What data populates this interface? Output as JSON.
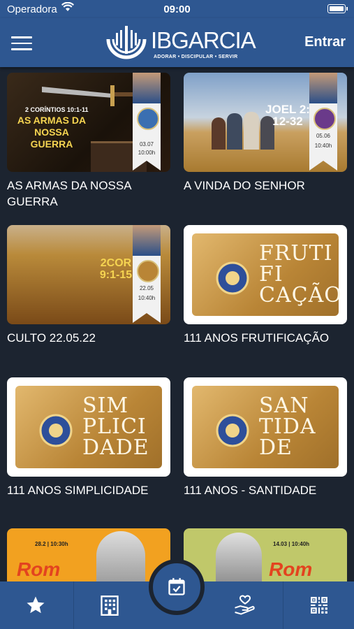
{
  "status_bar": {
    "carrier": "Operadora",
    "time": "09:00"
  },
  "header": {
    "logo_text": "IBGARCIA",
    "logo_subtitle": "ADORAR • DISCIPULAR • SERVIR",
    "login_label": "Entrar"
  },
  "cards": [
    {
      "title": "AS ARMAS DA NOSSA GUERRA",
      "thumb_ref": "2 CORÍNTIOS 10:1-11",
      "thumb_heading": "AS ARMAS DA NOSSA GUERRA",
      "ribbon_date": "03.07",
      "ribbon_time": "10:00h"
    },
    {
      "title": "A VINDA DO SENHOR",
      "thumb_ref": "JOEL 2: 12-32",
      "ribbon_date": "05.06",
      "ribbon_time": "10:40h"
    },
    {
      "title": "CULTO 22.05.22",
      "thumb_ref": "2COR 9:1-15",
      "ribbon_date": "22.05",
      "ribbon_time": "10:40h"
    },
    {
      "title": "111 ANOS FRUTIFICAÇÃO",
      "thumb_word": "FRUTI FI CAÇÃO"
    },
    {
      "title": "111 ANOS SIMPLICIDADE",
      "thumb_word": "SIM PLICI DADE"
    },
    {
      "title": "111 ANOS - SANTIDADE",
      "thumb_word": "SAN TIDA DE"
    },
    {
      "title": "",
      "thumb_text": "Rom",
      "thumb_date": "28.2 | 10:30h"
    },
    {
      "title": "",
      "thumb_text": "Rom",
      "thumb_date": "14.03 | 10:40h"
    }
  ],
  "tabs": [
    {
      "name": "favorites",
      "icon": "star-icon"
    },
    {
      "name": "church",
      "icon": "building-icon"
    },
    {
      "name": "schedule",
      "icon": "calendar-check-icon"
    },
    {
      "name": "donate",
      "icon": "hand-heart-icon"
    },
    {
      "name": "qr",
      "icon": "qr-code-icon"
    }
  ],
  "colors": {
    "primary": "#2e5791",
    "background": "#1c2430",
    "text": "#ffffff"
  }
}
